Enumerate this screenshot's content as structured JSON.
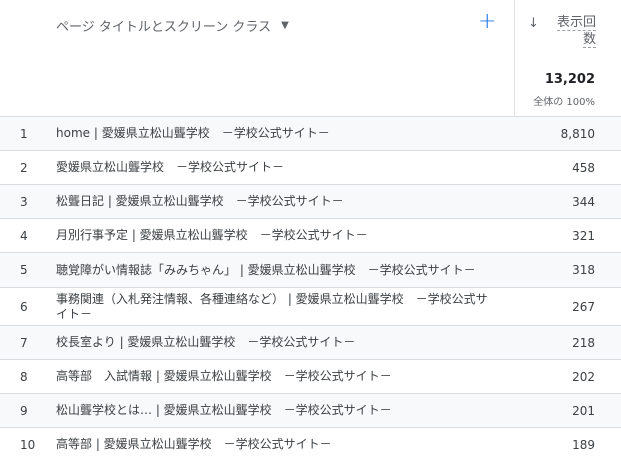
{
  "header": {
    "dimension_label": "ページ タイトルとスクリーン クラス",
    "add_icon": "plus-icon",
    "sort_icon": "arrow-down-icon",
    "metric_label_line1": "表示回",
    "metric_label_line2": "数",
    "total": "13,202",
    "total_sub": "全体の 100%"
  },
  "colors": {
    "accent": "#1a73e8",
    "shade": "#f8f9fa",
    "border": "#dadce0"
  },
  "rows": [
    {
      "index": "1",
      "title": "home | 愛媛県立松山聾学校　－学校公式サイト－",
      "value": "8,810"
    },
    {
      "index": "2",
      "title": "愛媛県立松山聾学校　－学校公式サイト－",
      "value": "458"
    },
    {
      "index": "3",
      "title": "松聾日記 | 愛媛県立松山聾学校　－学校公式サイト－",
      "value": "344"
    },
    {
      "index": "4",
      "title": "月別行事予定 | 愛媛県立松山聾学校　－学校公式サイト－",
      "value": "321"
    },
    {
      "index": "5",
      "title": "聴覚障がい情報誌「みみちゃん」 | 愛媛県立松山聾学校　－学校公式サイト－",
      "value": "318"
    },
    {
      "index": "6",
      "title": "事務関連（入札発注情報、各種連絡など） | 愛媛県立松山聾学校　－学校公式サイト－",
      "value": "267"
    },
    {
      "index": "7",
      "title": "校長室より | 愛媛県立松山聾学校　－学校公式サイト－",
      "value": "218"
    },
    {
      "index": "8",
      "title": "高等部　入試情報 | 愛媛県立松山聾学校　－学校公式サイト－",
      "value": "202"
    },
    {
      "index": "9",
      "title": "松山聾学校とは… | 愛媛県立松山聾学校　－学校公式サイト－",
      "value": "201"
    },
    {
      "index": "10",
      "title": "高等部 | 愛媛県立松山聾学校　－学校公式サイト－",
      "value": "189"
    }
  ]
}
